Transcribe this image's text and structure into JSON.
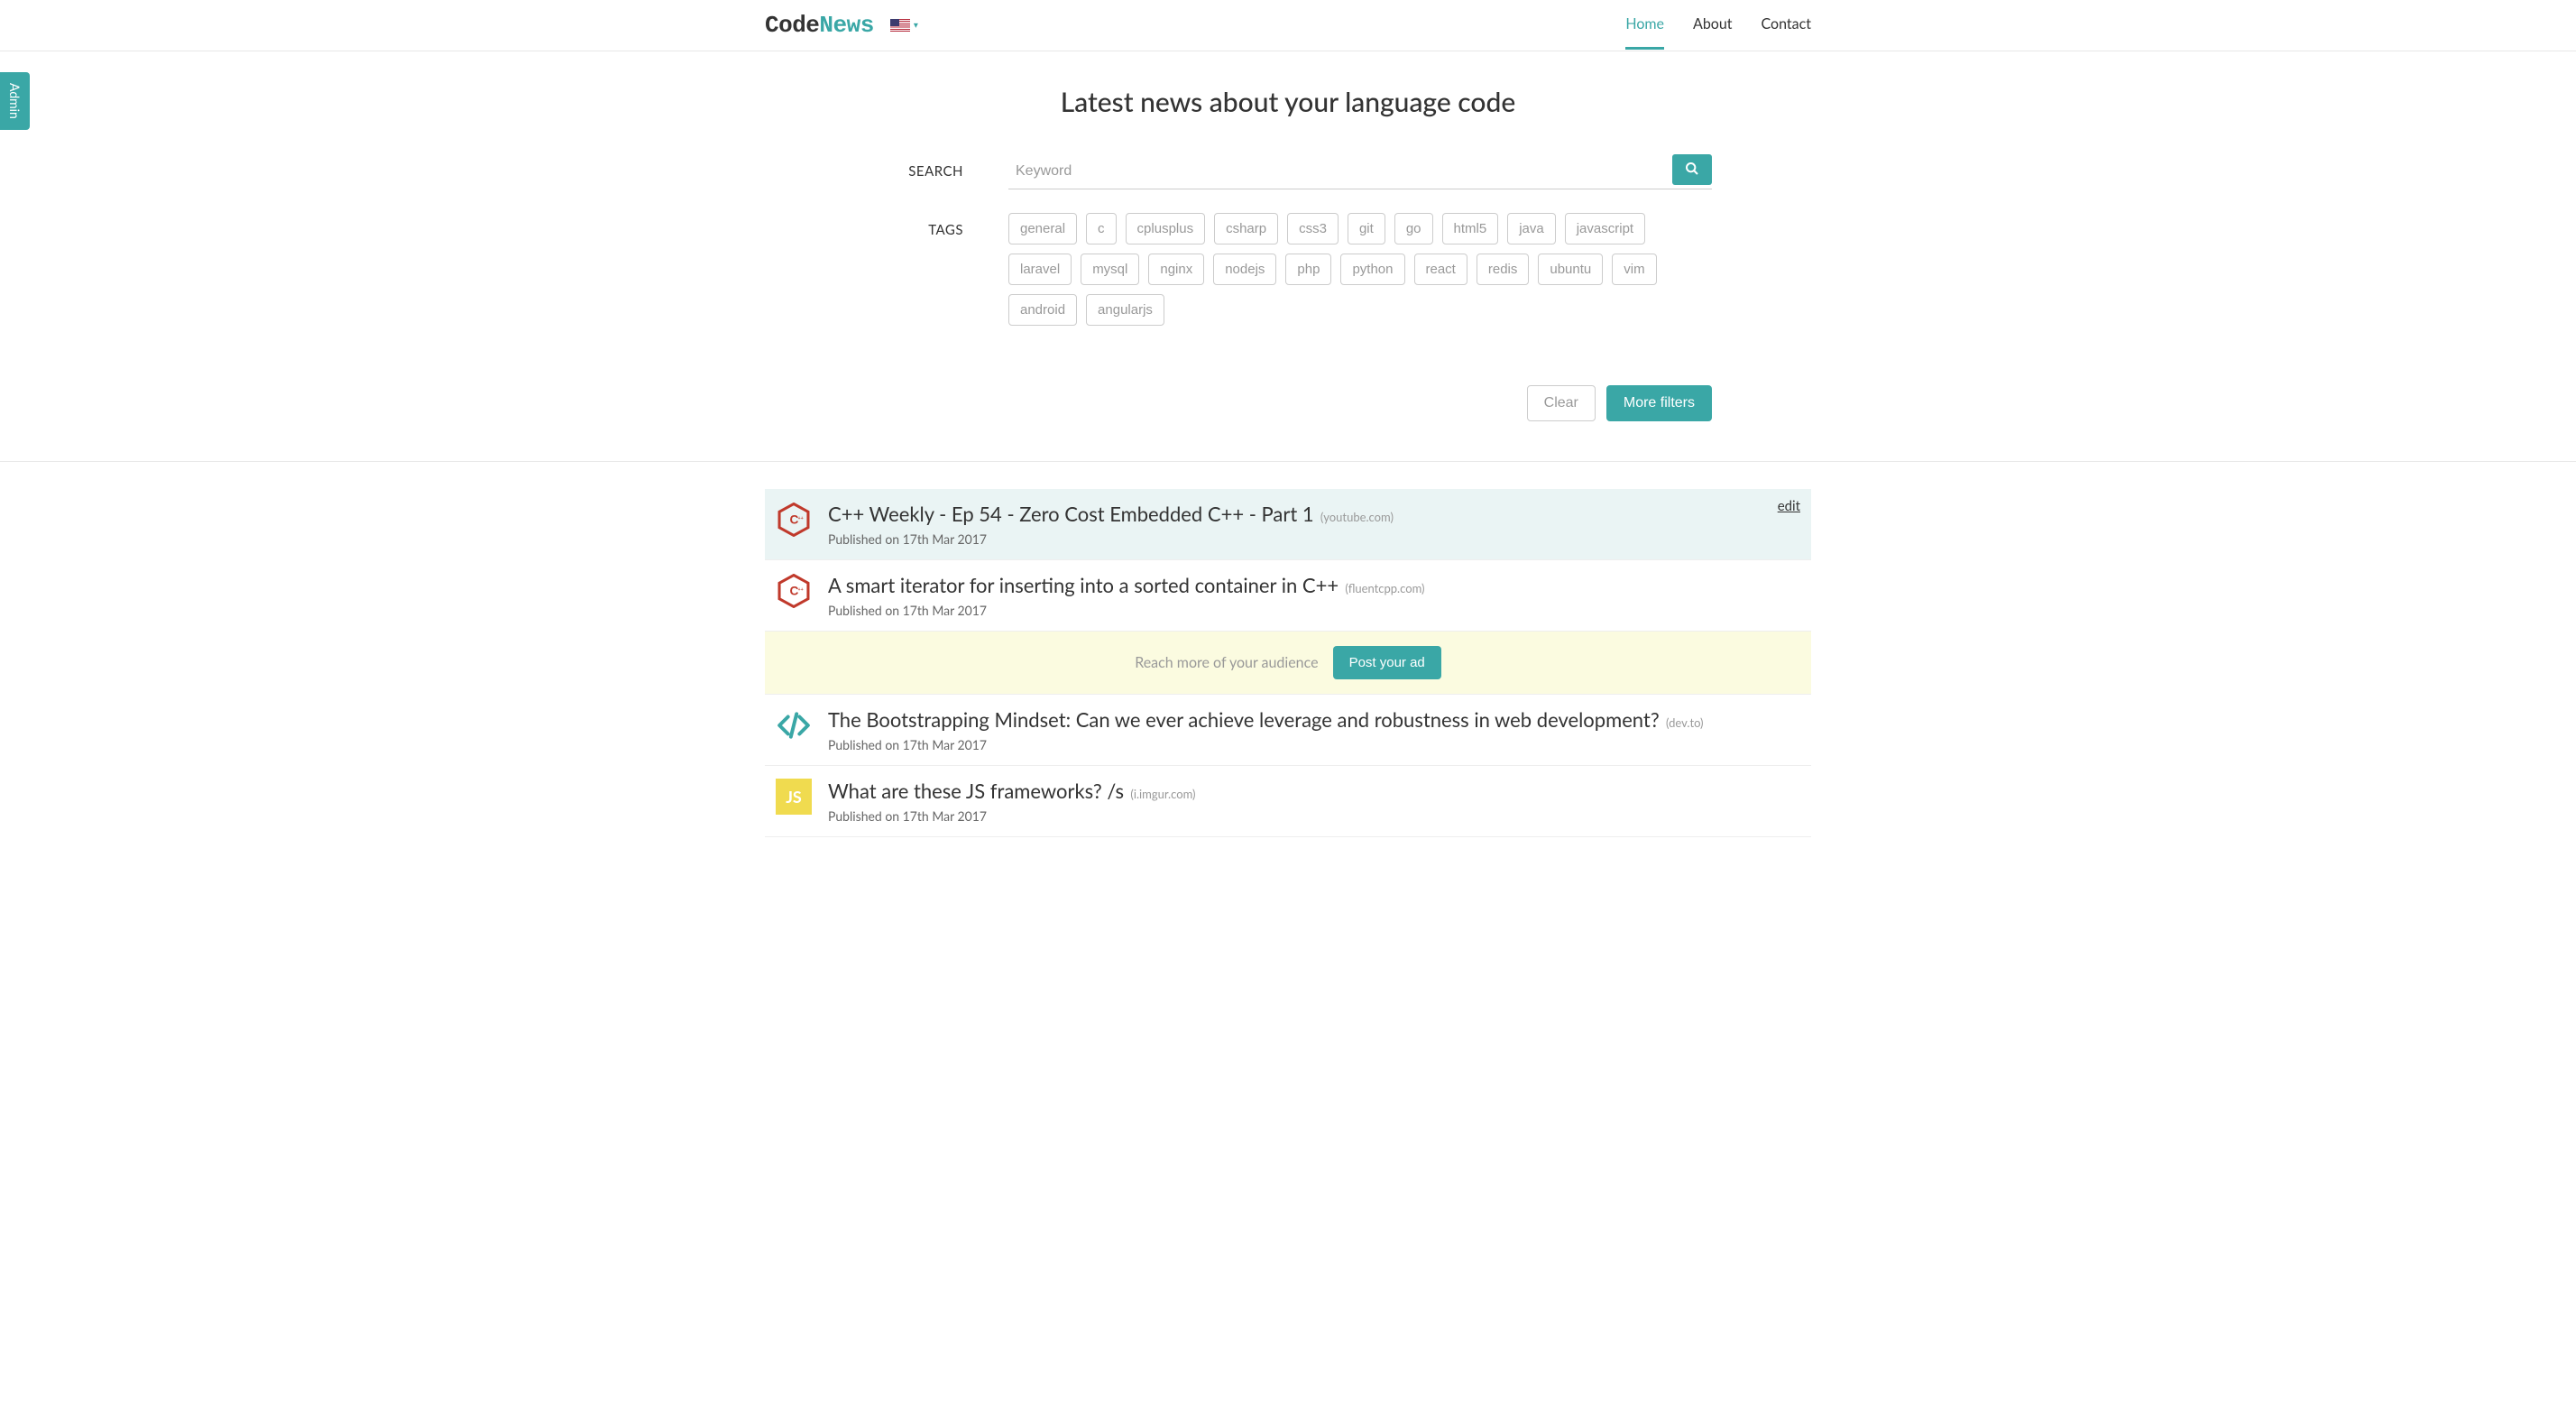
{
  "admin_label": "Admin",
  "logo": {
    "code": "Code",
    "news": "News"
  },
  "nav": {
    "home": "Home",
    "about": "About",
    "contact": "Contact"
  },
  "hero_title": "Latest news about your language code",
  "search": {
    "label": "SEARCH",
    "placeholder": "Keyword"
  },
  "tags_label": "TAGS",
  "tags": [
    "general",
    "c",
    "cplusplus",
    "csharp",
    "css3",
    "git",
    "go",
    "html5",
    "java",
    "javascript",
    "laravel",
    "mysql",
    "nginx",
    "nodejs",
    "php",
    "python",
    "react",
    "redis",
    "ubuntu",
    "vim",
    "android",
    "angularjs"
  ],
  "actions": {
    "clear": "Clear",
    "more_filters": "More filters"
  },
  "posts": [
    {
      "title": "C++ Weekly - Ep 54 - Zero Cost Embedded C++ - Part 1",
      "domain": "(youtube.com)",
      "meta": "Published on 17th Mar 2017",
      "icon": "cpp",
      "highlight": true,
      "edit": "edit"
    },
    {
      "title": "A smart iterator for inserting into a sorted container in C++",
      "domain": "(fluentcpp.com)",
      "meta": "Published on 17th Mar 2017",
      "icon": "cpp"
    },
    {
      "title": "The Bootstrapping Mindset: Can we ever achieve leverage and robustness in web development?",
      "domain": "(dev.to)",
      "meta": "Published on 17th Mar 2017",
      "icon": "code"
    },
    {
      "title": "What are these JS frameworks? /s",
      "domain": "(i.imgur.com)",
      "meta": "Published on 17th Mar 2017",
      "icon": "js"
    }
  ],
  "ad": {
    "text": "Reach more of your audience",
    "button": "Post your ad"
  }
}
